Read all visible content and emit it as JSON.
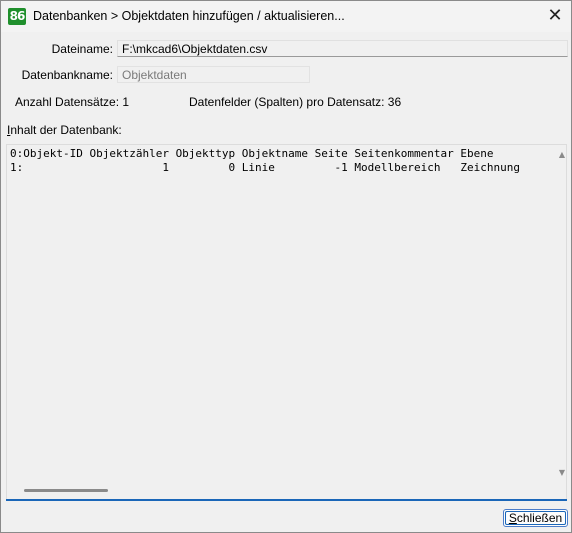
{
  "window": {
    "title": "Datenbanken > Objektdaten hinzufügen / aktualisieren...",
    "app_icon_text": "86",
    "close_glyph": "✕"
  },
  "form": {
    "filename_label": "Dateiname:",
    "filename_value": "F:\\mkcad6\\Objektdaten.csv",
    "dbname_label": "Datenbankname:",
    "dbname_value": "Objektdaten",
    "record_count_label": "Anzahl Datensätze: 1",
    "fields_label": "Datenfelder (Spalten) pro Datensatz: 36",
    "content_label": "Inhalt der Datenbank:"
  },
  "content": {
    "lines": [
      "0:Objekt-ID Objektzähler Objekttyp Objektname Seite Seitenkommentar Ebene",
      "1:                     1         0 Linie         -1 Modellbereich   Zeichnung"
    ]
  },
  "buttons": {
    "close_label": "Schließen"
  },
  "colors": {
    "accent": "#1a66b8",
    "app_icon": "#1f8f2c"
  }
}
